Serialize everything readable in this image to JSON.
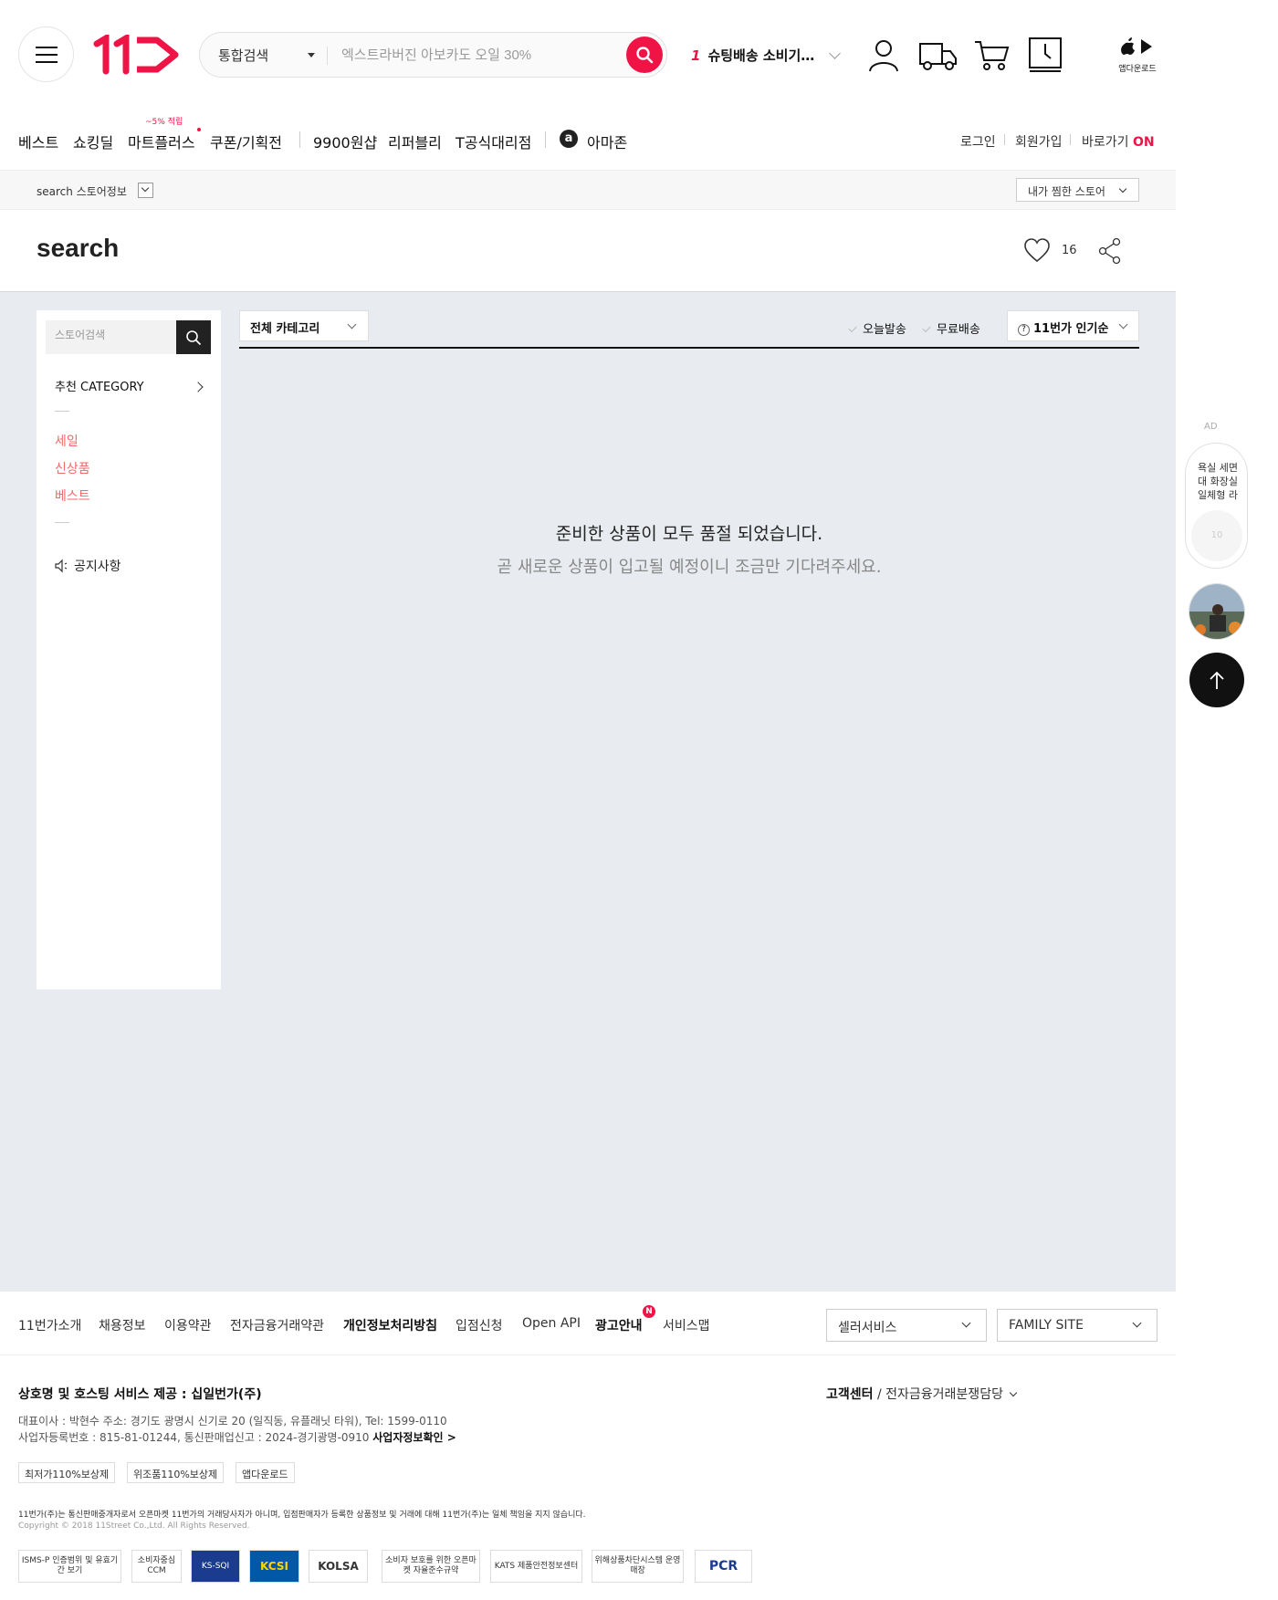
{
  "header": {
    "search_category": "통합검색",
    "search_placeholder": "엑스트라버진 아보카도 오일 30%",
    "rank_num": "1",
    "rank_text": "슈팅배송 소비기…",
    "app_download": "앱다운로드",
    "icons": [
      "menu-icon",
      "logo",
      "search-icon",
      "my-page-icon",
      "delivery-truck-icon",
      "cart-icon",
      "recent-clock-icon",
      "app-store-icon"
    ]
  },
  "gnb": {
    "items": [
      "베스트",
      "쇼킹딜",
      "마트플러스",
      "쿠폰/기획전",
      "9900원샵",
      "리퍼블리",
      "T공식대리점",
      "아마존"
    ],
    "badge": "~5% 적립",
    "amazon_icon": "a",
    "util": {
      "login": "로그인",
      "join": "회원가입",
      "shortcut": "바로가기",
      "shortcut_state": "ON"
    }
  },
  "store_bar": {
    "store_info": "search 스토어정보",
    "fav_store": "내가 찜한 스토어"
  },
  "title": {
    "name": "search",
    "likes": "16"
  },
  "lnb": {
    "search_placeholder": "스토어검색",
    "category_label": "추천 CATEGORY",
    "links": [
      "세일",
      "신상품",
      "베스트"
    ],
    "notice": "공지사항"
  },
  "filters": {
    "category": "전체 카테고리",
    "today_ship": "오늘발송",
    "free_ship": "무료배송",
    "sort_icon": "?",
    "sort": "11번가 인기순"
  },
  "empty": {
    "main": "준비한 상품이 모두 품절 되었습니다.",
    "sub": "곧 새로운 상품이 입고될 예정이니 조금만 기다려주세요."
  },
  "side": {
    "ad": "AD",
    "card_text": "욕실 세면대 화장실 일체형 라",
    "card_img": "10"
  },
  "footer": {
    "links": [
      "11번가소개",
      "채용정보",
      "이용약관",
      "전자금융거래약관",
      "개인정보처리방침",
      "입점신청",
      "Open API",
      "광고안내",
      "서비스맵"
    ],
    "new_badge": "N",
    "seller_service": "셀러서비스",
    "family_site": "FAMILY SITE",
    "company": "상호명 및 호스팅 서비스 제공 : 십일번가(주)",
    "cs_center": "고객센터",
    "cs_etc": " / 전자금융거래분쟁담당",
    "info1": "대표이사 : 박현수 주소: 경기도 광명시 신기로 20 (일직동, 유플래닛 타워), Tel: 1599-0110",
    "info2": "사업자등록번호 : 815-81-01244, 통신판매업신고 : 2024-경기광명-0910 ",
    "info2_link": "사업자정보확인 >",
    "badges": [
      "최저가110%보상제",
      "위조품110%보상제",
      "앱다운로드"
    ],
    "disclaimer": "11번가(주)는 통신판매중개자로서 오픈마켓 11번가의 거래당사자가 아니며, 입점판매자가 등록한 상품정보 및 거래에 대해 11번가(주)는 일체 책임을 지지 않습니다.",
    "copyright": "Copyright © 2018 11Street Co.,Ltd. All Rights Reserved.",
    "certs": [
      "ISMS-P 인증범위 및 유효기간 보기",
      "소비자중심 CCM",
      "KS-SQI",
      "KCSI",
      "KOLSA",
      "소비자 보호를 위한 오픈마켓 자율준수규약",
      "KATS 제품안전정보센터",
      "위해상품차단시스템 운영매장",
      "PCR"
    ]
  },
  "colors": {
    "accent": "#f01446",
    "content_bg": "#e8ebef",
    "link_red": "#f06a6a"
  }
}
